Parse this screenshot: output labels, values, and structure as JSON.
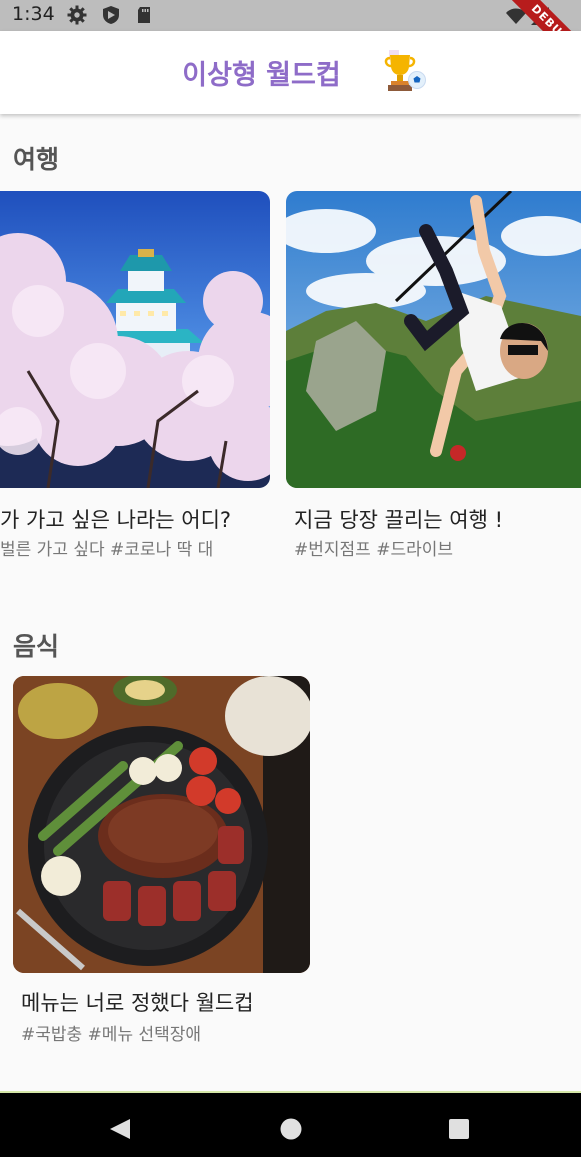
{
  "status_bar": {
    "time": "1:34",
    "debug_label": "DEBUG"
  },
  "app_bar": {
    "title": "이상형 월드컵",
    "trophy_icon": "trophy-icon"
  },
  "sections": [
    {
      "title": "여행",
      "cards": [
        {
          "title": "가 가고 싶은 나라는 어디?",
          "tags": "벌른 가고 싶다  #코로나 딱 대",
          "image": "osaka-castle-cherry-blossom"
        },
        {
          "title": "지금 당장 끌리는 여행 !",
          "tags": "#번지점프  #드라이브",
          "image": "zipline-mountain"
        }
      ]
    },
    {
      "title": "음식",
      "cards": [
        {
          "title": "메뉴는 너로 정했다 월드컵",
          "tags": "#국밥충  #메뉴 선택장애",
          "image": "steak-pan"
        }
      ]
    }
  ],
  "nav": {
    "back": "back-triangle-icon",
    "home": "home-circle-icon",
    "recents": "recents-square-icon"
  }
}
